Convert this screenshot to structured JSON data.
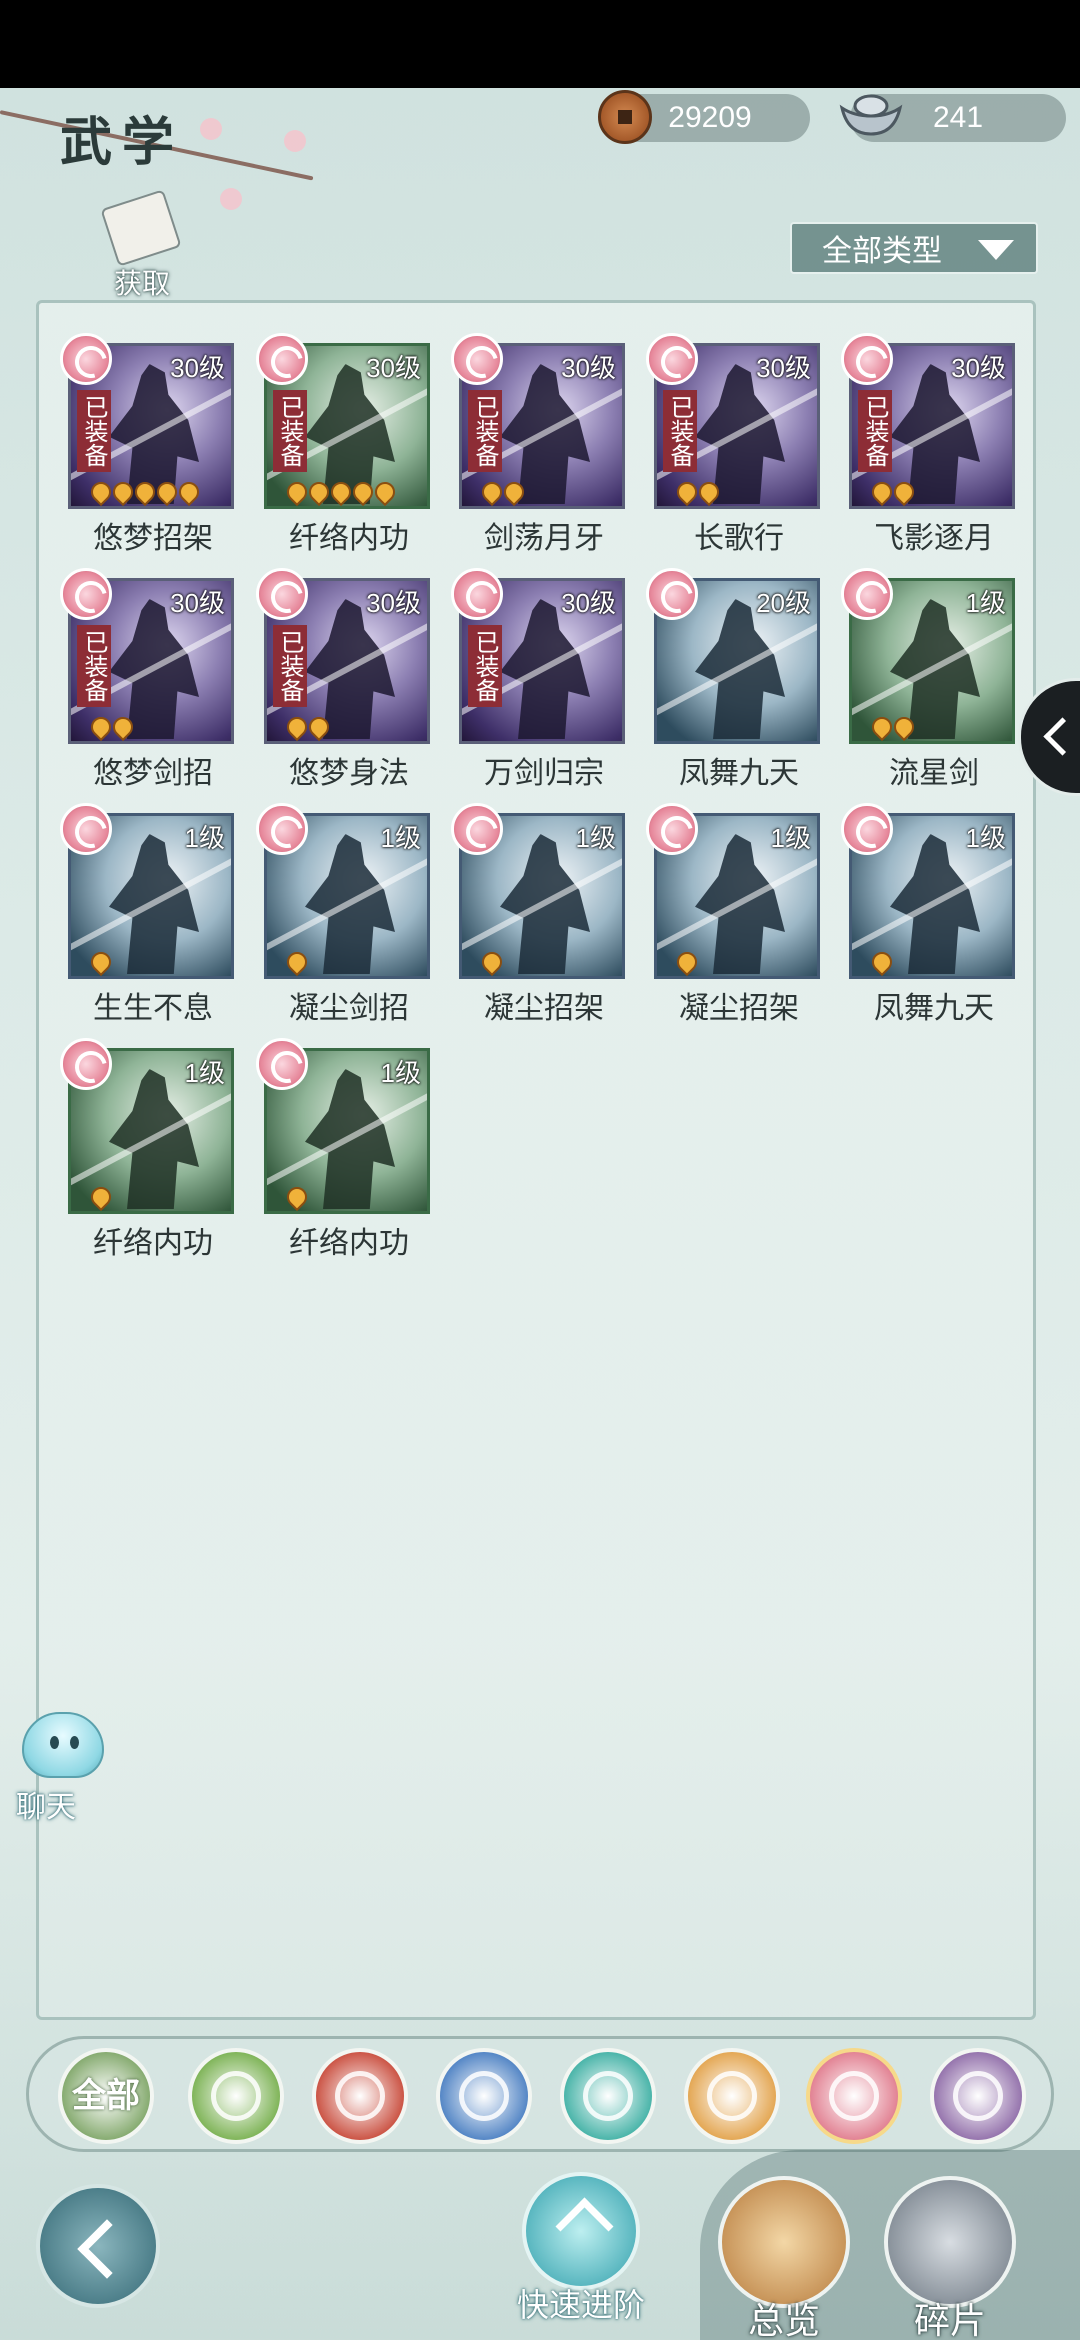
{
  "header": {
    "title": "武学",
    "copper": "29209",
    "silver": "241",
    "acquire_label": "获取",
    "type_filter": "全部类型"
  },
  "cards": [
    {
      "name": "悠梦招架",
      "level": "30级",
      "equipped": true,
      "flames": 5,
      "art": "purple"
    },
    {
      "name": "纤络内功",
      "level": "30级",
      "equipped": true,
      "flames": 5,
      "art": "green"
    },
    {
      "name": "剑荡月牙",
      "level": "30级",
      "equipped": true,
      "flames": 2,
      "art": "purple"
    },
    {
      "name": "长歌行",
      "level": "30级",
      "equipped": true,
      "flames": 2,
      "art": "purple"
    },
    {
      "name": "飞影逐月",
      "level": "30级",
      "equipped": true,
      "flames": 2,
      "art": "purple"
    },
    {
      "name": "悠梦剑招",
      "level": "30级",
      "equipped": true,
      "flames": 2,
      "art": "purple"
    },
    {
      "name": "悠梦身法",
      "level": "30级",
      "equipped": true,
      "flames": 2,
      "art": "purple"
    },
    {
      "name": "万剑归宗",
      "level": "30级",
      "equipped": true,
      "flames": 0,
      "art": "purple"
    },
    {
      "name": "凤舞九天",
      "level": "20级",
      "equipped": false,
      "flames": 0,
      "art": "blue"
    },
    {
      "name": "流星剑",
      "level": "1级",
      "equipped": false,
      "flames": 2,
      "art": "green"
    },
    {
      "name": "生生不息",
      "level": "1级",
      "equipped": false,
      "flames": 1,
      "art": "blue"
    },
    {
      "name": "凝尘剑招",
      "level": "1级",
      "equipped": false,
      "flames": 1,
      "art": "blue"
    },
    {
      "name": "凝尘招架",
      "level": "1级",
      "equipped": false,
      "flames": 1,
      "art": "blue"
    },
    {
      "name": "凝尘招架",
      "level": "1级",
      "equipped": false,
      "flames": 1,
      "art": "blue"
    },
    {
      "name": "凤舞九天",
      "level": "1级",
      "equipped": false,
      "flames": 1,
      "art": "blue"
    },
    {
      "name": "纤络内功",
      "level": "1级",
      "equipped": false,
      "flames": 1,
      "art": "green"
    },
    {
      "name": "纤络内功",
      "level": "1级",
      "equipped": false,
      "flames": 1,
      "art": "green"
    }
  ],
  "equipped_label": "已装备",
  "chat_label": "聊天",
  "categories": [
    {
      "id": "all",
      "label": "全部",
      "color": "#7fa668",
      "icon": "all-icon"
    },
    {
      "id": "sword",
      "label": "",
      "color": "#78b04f",
      "icon": "sword-icon"
    },
    {
      "id": "fire",
      "label": "",
      "color": "#c84a3a",
      "icon": "flame-icon"
    },
    {
      "id": "water",
      "label": "",
      "color": "#4a7fc2",
      "icon": "wave-icon"
    },
    {
      "id": "butterfly",
      "label": "",
      "color": "#3fb0a4",
      "icon": "butterfly-icon"
    },
    {
      "id": "shield",
      "label": "",
      "color": "#e2a24a",
      "icon": "shield-icon"
    },
    {
      "id": "moon",
      "label": "",
      "color": "#e07b8d",
      "icon": "moon-icon"
    },
    {
      "id": "rose",
      "label": "",
      "color": "#8f6ca8",
      "icon": "rose-icon"
    }
  ],
  "bottom": {
    "quick_advance": "快速进阶",
    "overview": "总览",
    "fragments": "碎片"
  }
}
